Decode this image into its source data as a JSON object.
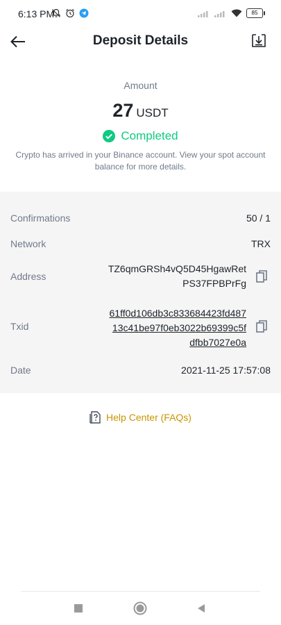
{
  "status_bar": {
    "time": "6:13 PM",
    "battery": "85",
    "left_icons": [
      "mute-bell-icon",
      "alarm-icon",
      "telegram-icon"
    ],
    "right_icons": [
      "signal-icon",
      "signal-icon",
      "wifi-icon",
      "battery-icon"
    ]
  },
  "header": {
    "title": "Deposit Details",
    "back_icon": "arrow-left-icon",
    "download_icon": "download-icon"
  },
  "amount": {
    "label": "Amount",
    "value": "27",
    "unit": "USDT",
    "status": "Completed",
    "status_color": "#0ecb81",
    "info": "Crypto has arrived in your Binance account. View your spot account balance for more details."
  },
  "details": {
    "confirmations_label": "Confirmations",
    "confirmations_value": "50 / 1",
    "network_label": "Network",
    "network_value": "TRX",
    "address_label": "Address",
    "address_line1": "TZ6qmGRSh4vQ5D45HgawRet",
    "address_line2": "PS37FPBPrFg",
    "txid_label": "Txid",
    "txid_line1": "61ff0d106db3c833684423fd487",
    "txid_line2": "13c41be97f0eb3022b69399c5f",
    "txid_line3": "dfbb7027e0a",
    "date_label": "Date",
    "date_value": "2021-11-25 17:57:08"
  },
  "help": {
    "label": "Help Center (FAQs)",
    "color": "#c99400"
  },
  "nav": {
    "icons": [
      "recents-square-icon",
      "home-circle-icon",
      "back-triangle-icon"
    ]
  }
}
